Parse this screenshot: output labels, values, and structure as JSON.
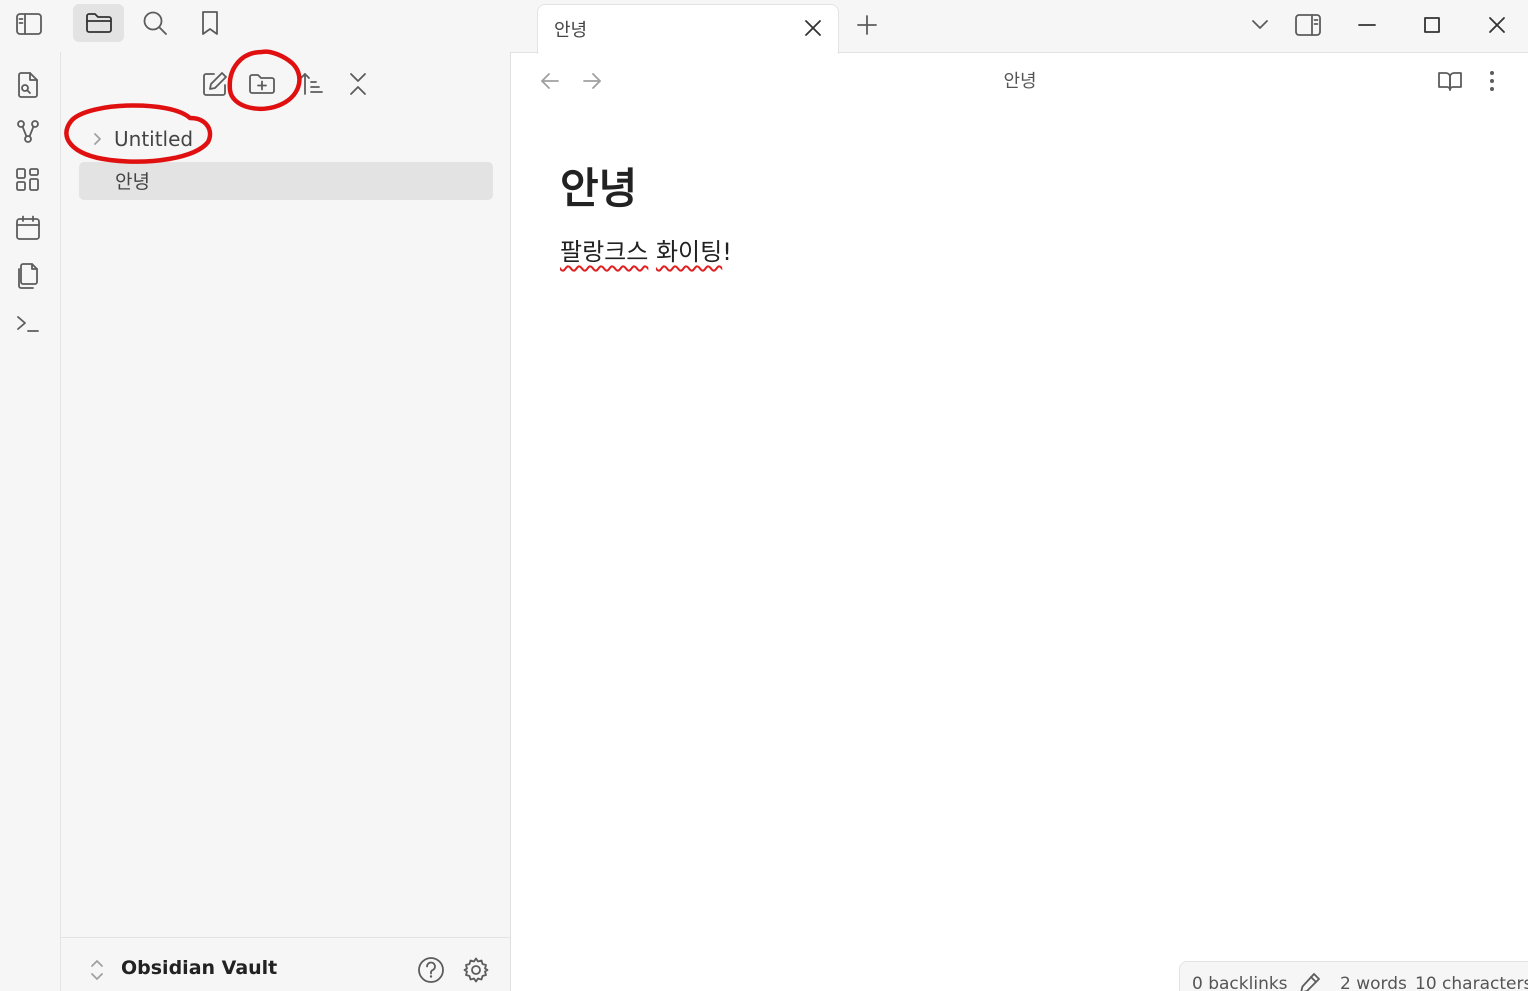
{
  "tab": {
    "title": "안녕"
  },
  "navigation": {
    "title": "안녕"
  },
  "note": {
    "heading": "안녕",
    "body_parts": [
      "팔랑크스",
      " ",
      "화이팅",
      "!"
    ]
  },
  "file_tree": {
    "folder_label": "Untitled",
    "file_label": "안녕"
  },
  "vault": {
    "name": "Obsidian Vault"
  },
  "status_bar": {
    "backlinks": "0 backlinks",
    "words": "2 words",
    "characters": "10 characters"
  },
  "colors": {
    "sidebar_bg": "#f6f6f6",
    "selected_item_bg": "#e3e3e3",
    "annotation_red": "#e01010",
    "spellcheck_red": "#e02020"
  }
}
